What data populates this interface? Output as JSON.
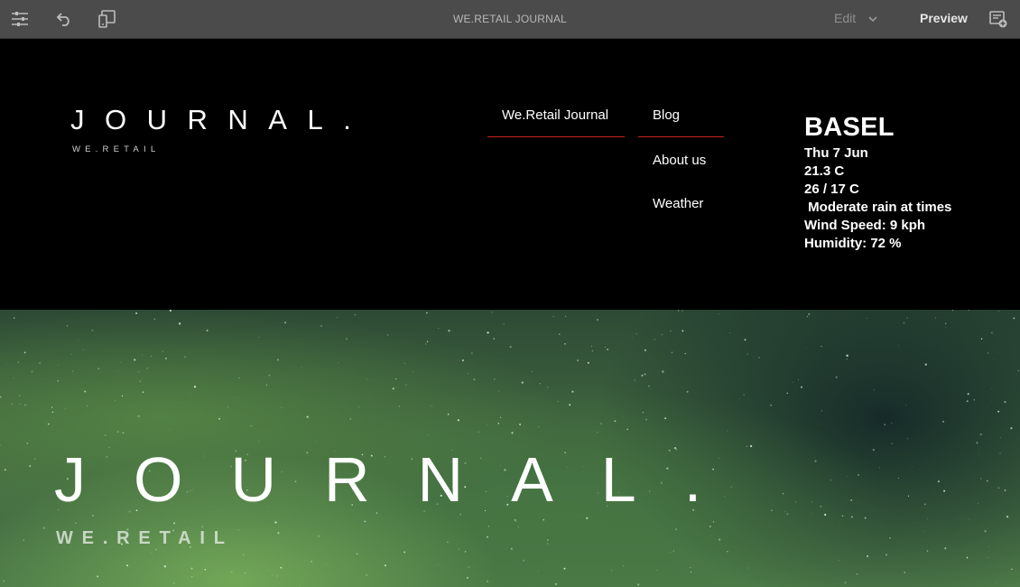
{
  "toolbar": {
    "title": "WE.RETAIL JOURNAL",
    "mode_label": "Edit",
    "preview_label": "Preview",
    "icons": [
      "page-properties-icon",
      "undo-icon",
      "emulator-icon",
      "chevron-down-icon",
      "annotations-icon"
    ]
  },
  "header": {
    "logo_text": "JOURNAL.",
    "logo_subtext": "WE.RETAIL",
    "nav": {
      "journal": "We.Retail Journal",
      "blog": "Blog",
      "about": "About us",
      "weather": "Weather"
    },
    "accent_color": "#c8231e"
  },
  "weather": {
    "city": "BASEL",
    "date": "Thu 7 Jun",
    "temperature": "21.3 C",
    "range": "26 / 17 C",
    "description": " Moderate rain at times",
    "wind": "Wind Speed: 9 kph",
    "humidity": "Humidity: 72 %"
  },
  "hero": {
    "title": "JOURNAL.",
    "subtitle": "WE.RETAIL"
  }
}
